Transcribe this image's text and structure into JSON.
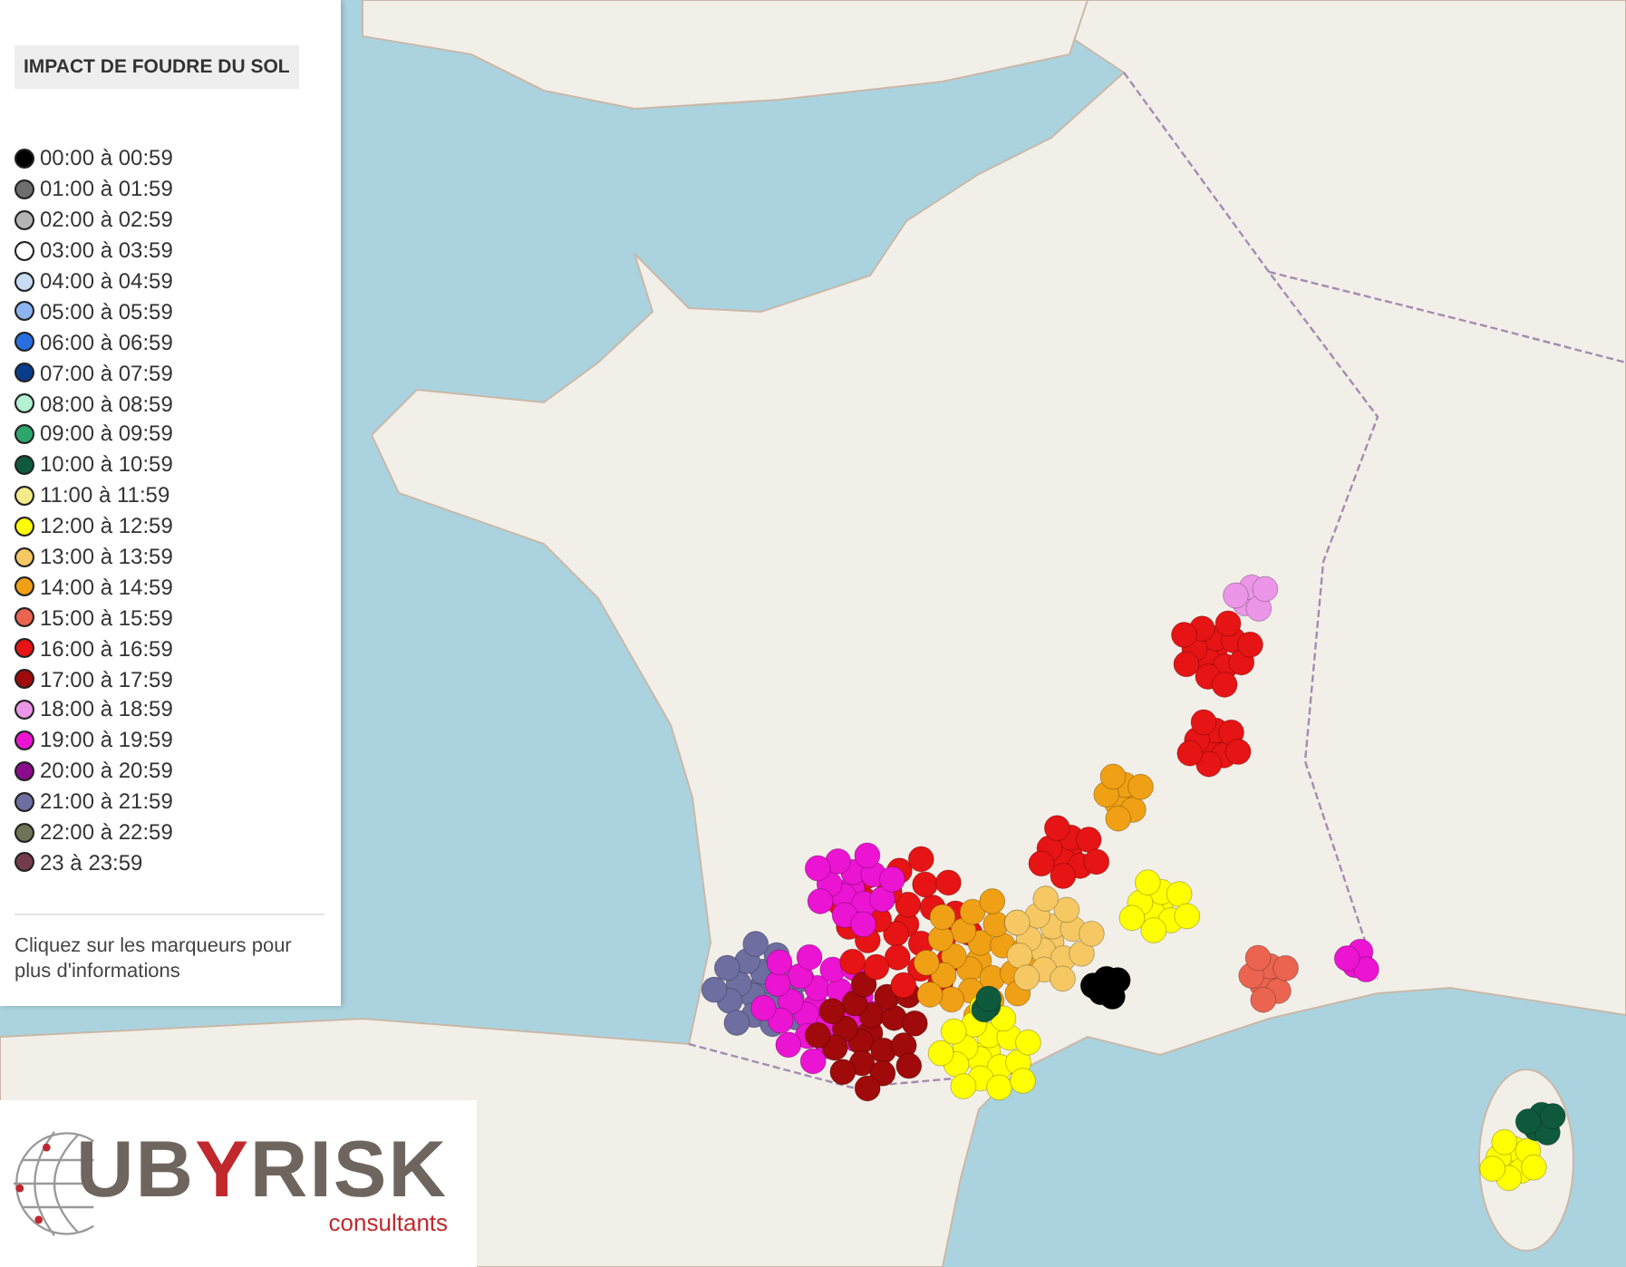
{
  "legend": {
    "title": "IMPACT DE FOUDRE DU SOL",
    "items": [
      {
        "label": "00:00 à 00:59",
        "color": "#000000"
      },
      {
        "label": "01:00 à 01:59",
        "color": "#6e6e6e"
      },
      {
        "label": "02:00 à 02:59",
        "color": "#b4b4b4"
      },
      {
        "label": "03:00 à 03:59",
        "color": "#ffffff"
      },
      {
        "label": "04:00 à 04:59",
        "color": "#c8dcf5"
      },
      {
        "label": "05:00 à 05:59",
        "color": "#8cb4f0"
      },
      {
        "label": "06:00 à 06:59",
        "color": "#2a6fe0"
      },
      {
        "label": "07:00 à 07:59",
        "color": "#0a3c8c"
      },
      {
        "label": "08:00 à 08:59",
        "color": "#b4f0d2"
      },
      {
        "label": "09:00 à 09:59",
        "color": "#2fa56e"
      },
      {
        "label": "10:00 à 10:59",
        "color": "#0f5a3c"
      },
      {
        "label": "11:00 à 11:59",
        "color": "#f5eb8c"
      },
      {
        "label": "12:00 à 12:59",
        "color": "#ffff00"
      },
      {
        "label": "13:00 à 13:59",
        "color": "#f5c864"
      },
      {
        "label": "14:00 à 14:59",
        "color": "#f0a014"
      },
      {
        "label": "15:00 à 15:59",
        "color": "#eb6450"
      },
      {
        "label": "16:00 à 16:59",
        "color": "#e61414"
      },
      {
        "label": "17:00 à 17:59",
        "color": "#a00a0a"
      },
      {
        "label": "18:00 à 18:59",
        "color": "#eb96e6"
      },
      {
        "label": "19:00 à 19:59",
        "color": "#eb14d2"
      },
      {
        "label": "20:00 à 20:59",
        "color": "#8c0a8c"
      },
      {
        "label": "21:00 à 21:59",
        "color": "#6e6ea0"
      },
      {
        "label": "22:00 à 22:59",
        "color": "#6e7355"
      },
      {
        "label": "23 à 23:59",
        "color": "#733c4b"
      }
    ],
    "note": "Cliquez sur les marqueurs pour plus d'informations"
  },
  "logo": {
    "parts": [
      {
        "text": "UB",
        "accent": false
      },
      {
        "text": "Y",
        "accent": true
      },
      {
        "text": "RISK",
        "accent": false
      }
    ],
    "tagline": "consultants"
  }
}
